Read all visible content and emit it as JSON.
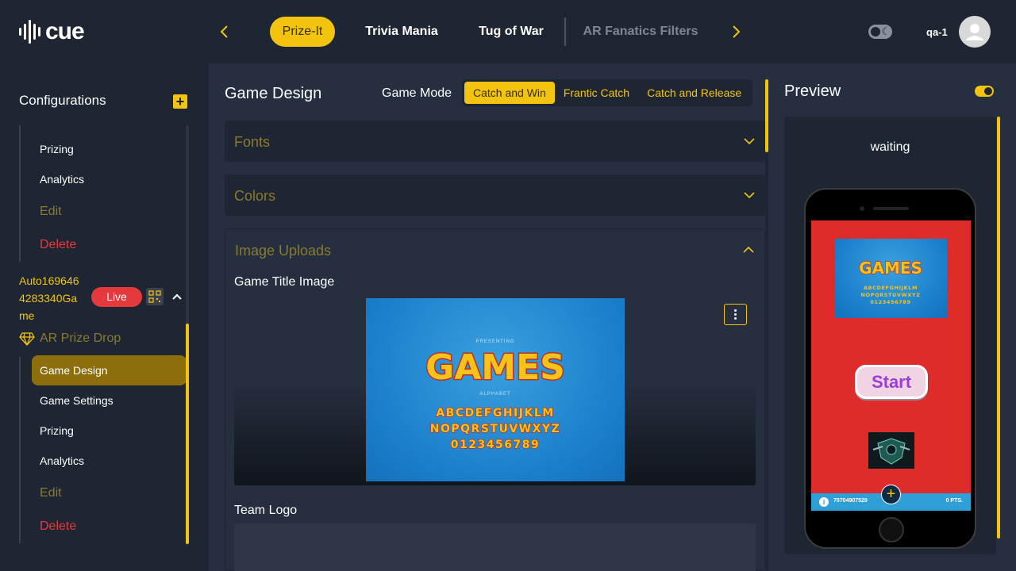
{
  "app": {
    "logo_text": "cue"
  },
  "header": {
    "tabs": [
      {
        "label": "Prize-It",
        "active": true
      },
      {
        "label": "Trivia Mania"
      },
      {
        "label": "Tug of War"
      },
      {
        "label": "AR Fanatics Filters",
        "dim": true
      }
    ],
    "user_name": "qa-1"
  },
  "sidebar": {
    "title": "Configurations",
    "items_top": [
      {
        "label": "Prizing"
      },
      {
        "label": "Analytics"
      },
      {
        "label": "Edit"
      },
      {
        "label": "Delete"
      }
    ],
    "game": {
      "name": "Auto1696464283340Game",
      "name_lines": [
        "Auto169646",
        "4283340Ga",
        "me"
      ],
      "status": "Live",
      "type": "AR Prize Drop"
    },
    "items_bottom": [
      {
        "label": "Game Design",
        "active": true
      },
      {
        "label": "Game Settings"
      },
      {
        "label": "Prizing"
      },
      {
        "label": "Analytics"
      },
      {
        "label": "Edit"
      },
      {
        "label": "Delete"
      }
    ]
  },
  "main": {
    "title": "Game Design",
    "game_mode_label": "Game Mode",
    "game_modes": [
      {
        "label": "Catch and Win",
        "active": true
      },
      {
        "label": "Frantic Catch"
      },
      {
        "label": "Catch and Release"
      }
    ],
    "sections": {
      "fonts": "Fonts",
      "colors": "Colors",
      "image_uploads": "Image Uploads"
    },
    "game_title_image_label": "Game Title Image",
    "team_logo_label": "Team Logo",
    "games_art": {
      "presenting": "PRESENTING",
      "title": "GAMES",
      "subtitle": "ALPHABET",
      "row1": "ABCDEFGHIJKLM",
      "row2": "NOPQRSTUVWXYZ",
      "row3": "0123456789"
    }
  },
  "preview": {
    "title": "Preview",
    "status": "waiting",
    "start_label": "Start",
    "user_id": "70704907529",
    "points": "0 PTS."
  },
  "colors": {
    "accent": "#f2c40f",
    "background": "#1f2633",
    "panel": "#262f3f",
    "danger": "#e5393e",
    "preview_screen": "#e02b2b"
  }
}
